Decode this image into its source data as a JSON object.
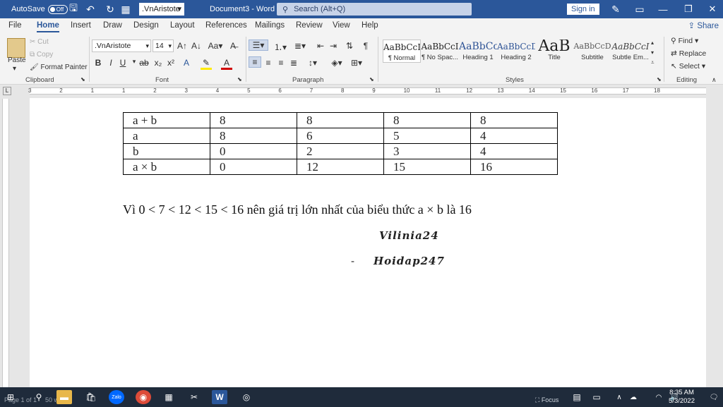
{
  "titlebar": {
    "autosave_label": "AutoSave",
    "autosave_state": "Off",
    "font_box": ".VnAristote",
    "doc_title": "Document3 - Word",
    "search_placeholder": "Search (Alt+Q)",
    "signin_label": "Sign in"
  },
  "tabs": [
    "File",
    "Home",
    "Insert",
    "Draw",
    "Design",
    "Layout",
    "References",
    "Mailings",
    "Review",
    "View",
    "Help"
  ],
  "share_label": "Share",
  "ribbon": {
    "clipboard": {
      "paste": "Paste",
      "cut": "Cut",
      "copy": "Copy",
      "format_painter": "Format Painter",
      "label": "Clipboard"
    },
    "font": {
      "name": ".VnAristote",
      "size": "14",
      "label": "Font"
    },
    "paragraph": {
      "label": "Paragraph"
    },
    "styles": {
      "label": "Styles",
      "items": [
        {
          "preview": "AaBbCcI",
          "name": "¶ Normal"
        },
        {
          "preview": "AaBbCcI",
          "name": "¶ No Spac..."
        },
        {
          "preview": "AaBbCc",
          "name": "Heading 1"
        },
        {
          "preview": "AaBbCcD",
          "name": "Heading 2"
        },
        {
          "preview": "AaB",
          "name": "Title"
        },
        {
          "preview": "AaBbCcD",
          "name": "Subtitle"
        },
        {
          "preview": "AaBbCcI",
          "name": "Subtle Em..."
        }
      ]
    },
    "editing": {
      "find": "Find",
      "replace": "Replace",
      "select": "Select",
      "label": "Editing"
    }
  },
  "ruler_numbers": [
    "3",
    "2",
    "1",
    "1",
    "2",
    "3",
    "4",
    "5",
    "6",
    "7",
    "8",
    "9",
    "10",
    "11",
    "12",
    "13",
    "14",
    "15",
    "16",
    "17",
    "18"
  ],
  "document": {
    "table": [
      [
        "a + b",
        "8",
        "8",
        "8",
        "8"
      ],
      [
        "a",
        "8",
        "6",
        "5",
        "4"
      ],
      [
        "b",
        "0",
        "2",
        "3",
        "4"
      ],
      [
        "a × b",
        "0",
        "12",
        "15",
        "16"
      ]
    ],
    "paragraph": "Vì 0 < 7 < 12 < 15 < 16 nên giá trị lớn nhất của biểu thức a × b là 16",
    "signature1": "Vilinia24",
    "signature2_dash": "-",
    "signature2": "Hoidap247"
  },
  "statusbar": {
    "page": "Page 1 of 1",
    "words": "50 words",
    "focus": "Focus"
  },
  "taskbar": {
    "time": "8:35 AM",
    "date": "5/3/2022"
  }
}
